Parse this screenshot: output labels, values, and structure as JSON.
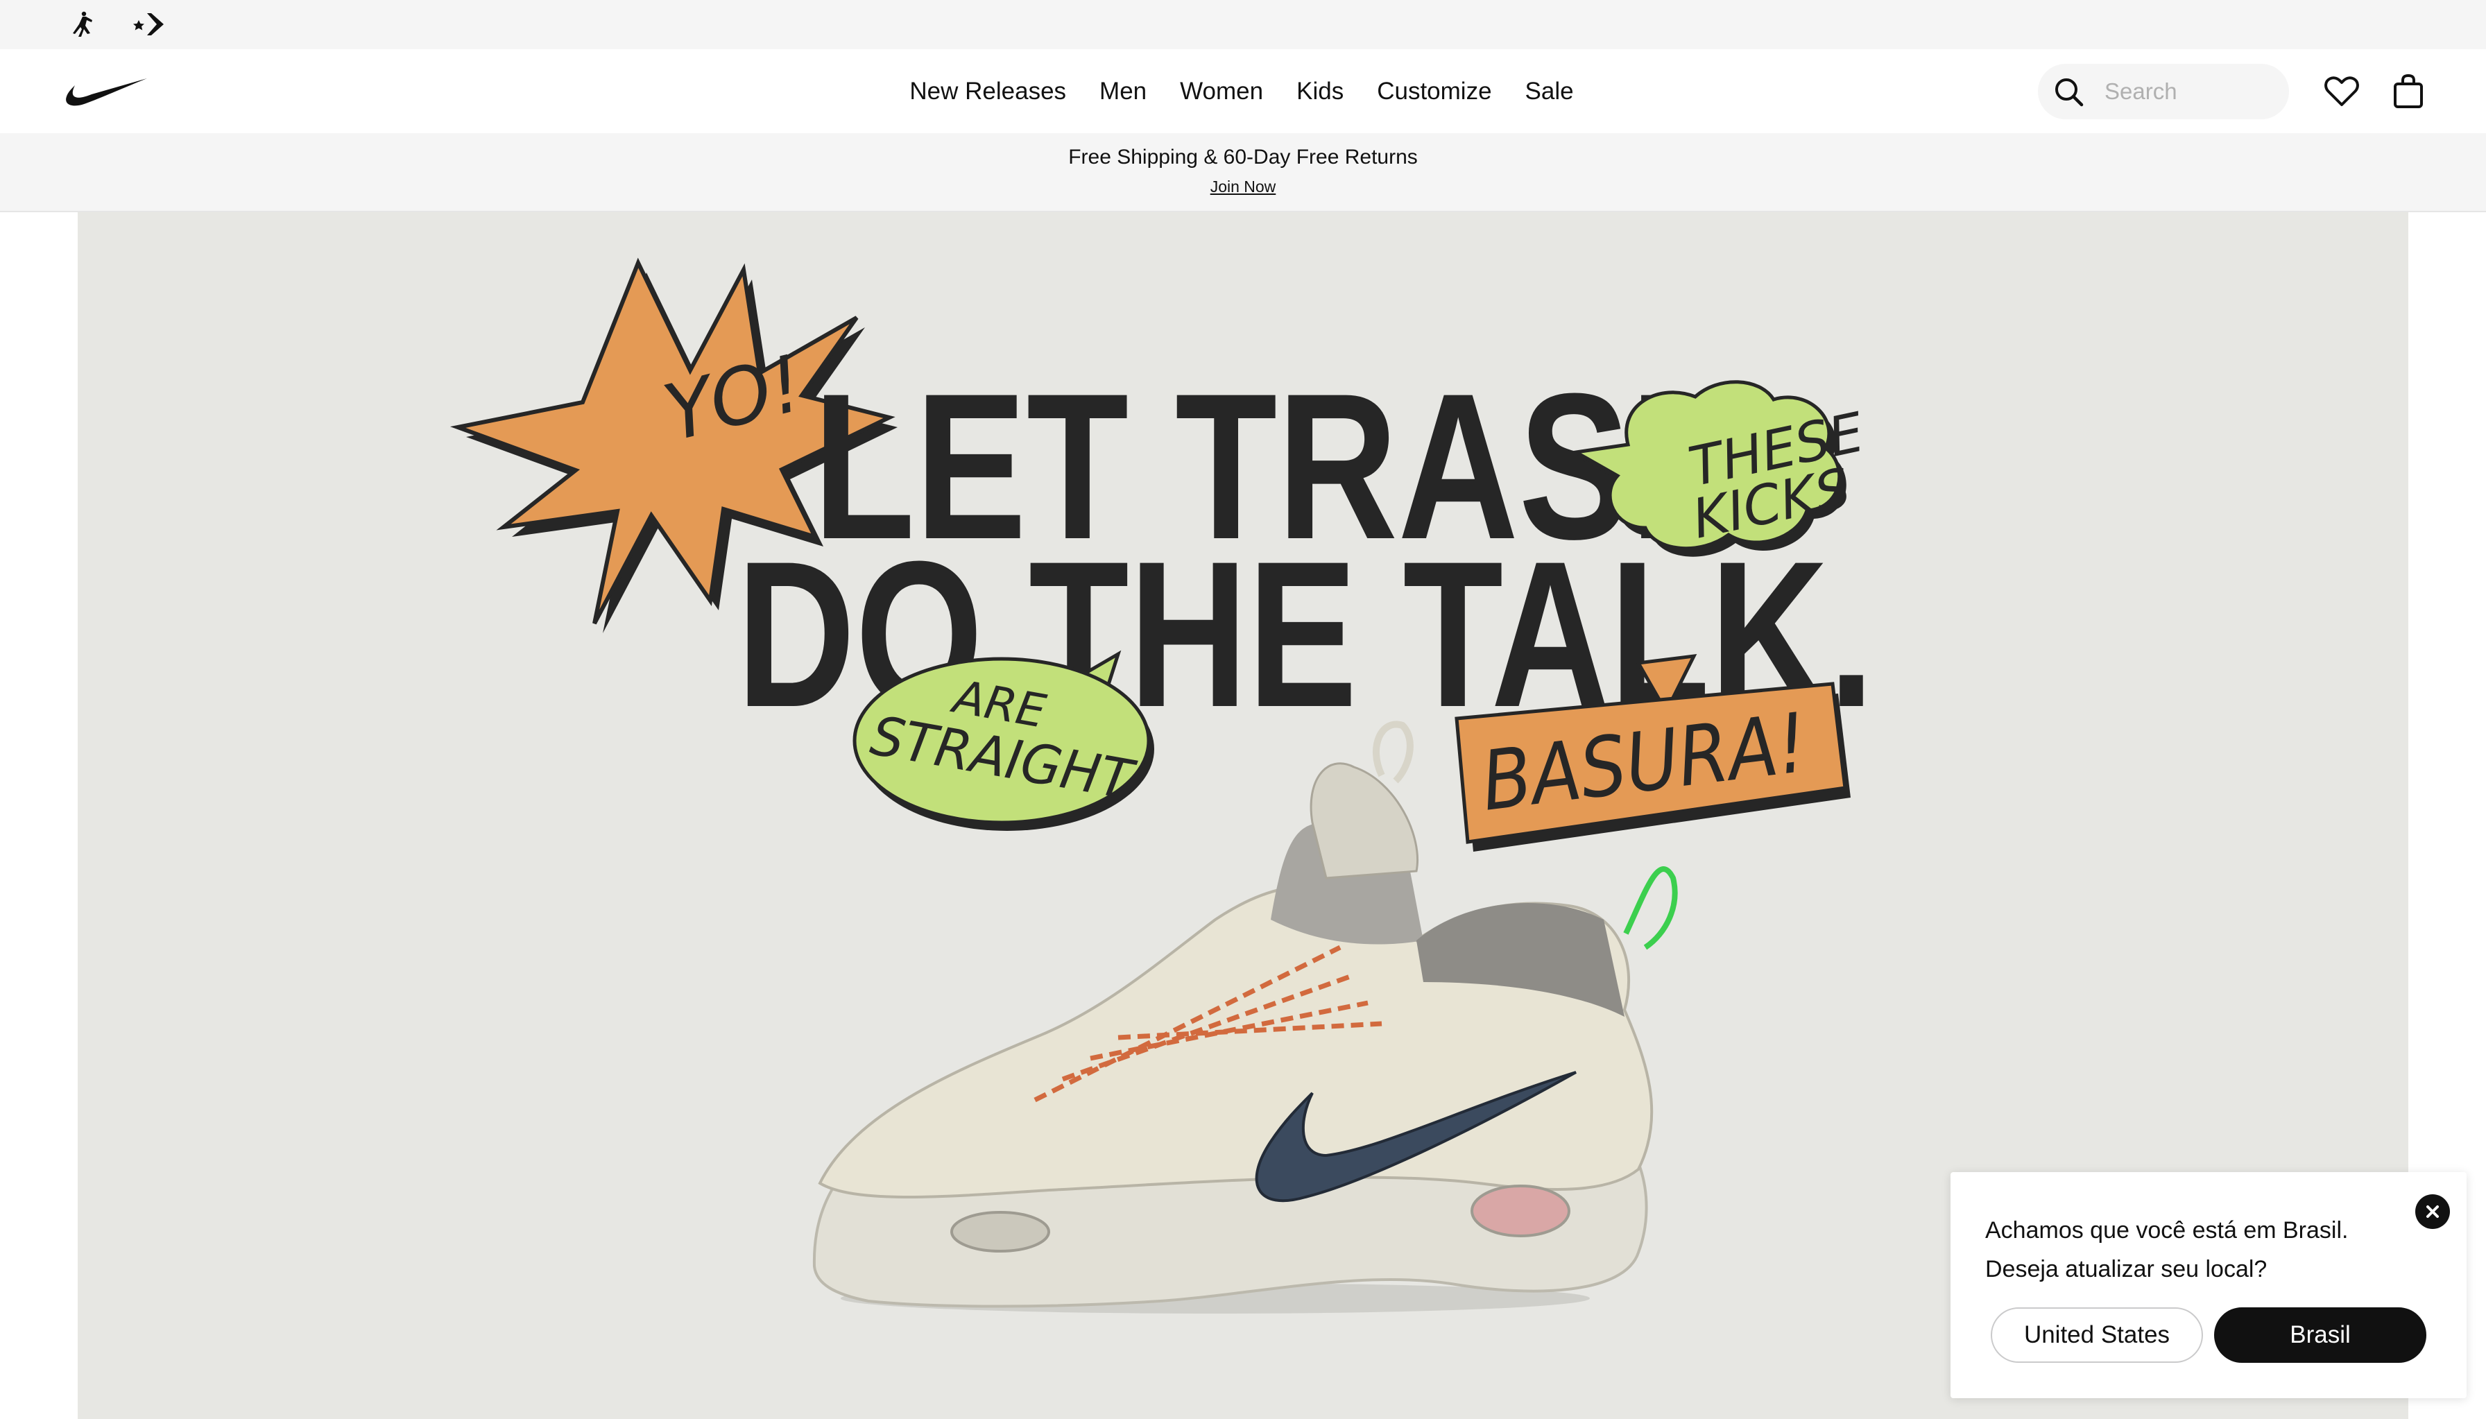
{
  "brand_bar": {
    "icons": [
      "jordan-jumpman-icon",
      "converse-icon"
    ]
  },
  "header": {
    "logo": "nike-swoosh-icon",
    "nav": [
      "New Releases",
      "Men",
      "Women",
      "Kids",
      "Customize",
      "Sale"
    ],
    "search": {
      "placeholder": "Search",
      "value": ""
    },
    "icons": [
      "search-icon",
      "heart-icon",
      "shopping-bag-icon"
    ]
  },
  "promo": {
    "title": "Free Shipping & 60-Day Free Returns",
    "link": "Join Now"
  },
  "hero": {
    "headline_line1": "LET TRASH",
    "headline_line2": "DO THE TALK.",
    "burst_text": "YO!",
    "bubble_right": [
      "THESE",
      "KICKS"
    ],
    "bubble_left": [
      "ARE",
      "STRAIGHT"
    ],
    "sign": "BASURA!",
    "colors": {
      "background": "#e7e7e3",
      "orange": "#e49a55",
      "lime": "#c2e07a",
      "ink": "#262626"
    }
  },
  "location_popup": {
    "line1": "Achamos que você está em Brasil.",
    "line2": "Deseja atualizar seu local?",
    "option_current": "United States",
    "option_suggested": "Brasil"
  }
}
